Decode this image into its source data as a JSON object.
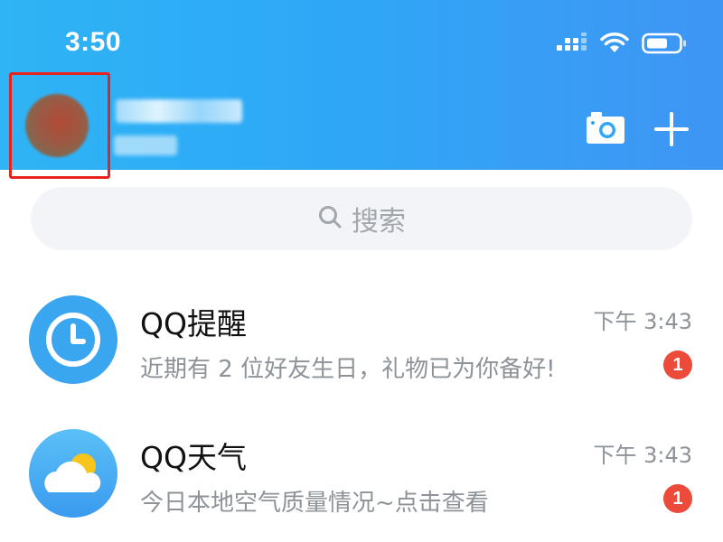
{
  "status_bar": {
    "time": "3:50",
    "icons": [
      "cellular-signal-icon",
      "wifi-icon",
      "battery-icon"
    ]
  },
  "header": {
    "avatar_icon": "blurred-profile-avatar",
    "actions": [
      "camera-icon",
      "plus-icon"
    ],
    "gradient_colors": [
      "#2fb4f5",
      "#3f95f4"
    ],
    "highlight_color": "#e8231d"
  },
  "search": {
    "placeholder": "搜索",
    "icon": "search-icon"
  },
  "chats": [
    {
      "name": "QQ提醒",
      "message": "近期有 2 位好友生日，礼物已为你备好!",
      "time": "下午 3:43",
      "unread": "1",
      "icon": "clock-icon"
    },
    {
      "name": "QQ天气",
      "message": "今日本地空气质量情况~点击查看",
      "time": "下午 3:43",
      "unread": "1",
      "icon": "weather-cloud-sun-icon"
    }
  ],
  "colors": {
    "badge": "#ec4a3b",
    "reminder_avatar": "#3aa6ef"
  }
}
